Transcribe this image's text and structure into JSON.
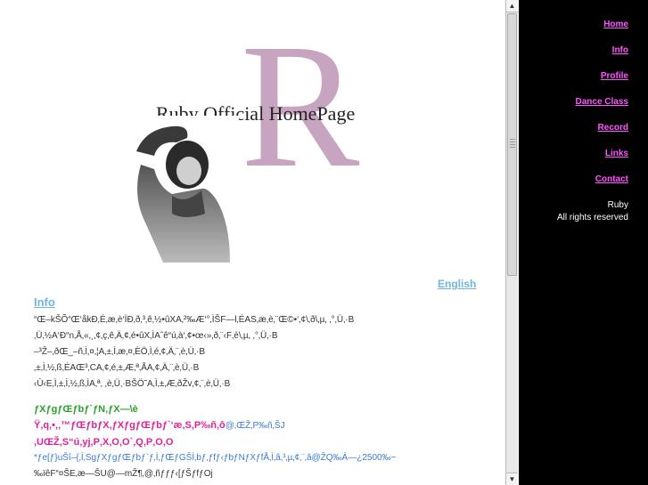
{
  "site": {
    "title": "Ruby Official HomePage",
    "logo_letter": "R"
  },
  "content": {
    "english_link": "English",
    "info_heading": "Info",
    "info_lines": [
      "“Œ–kŠÕ“Œ‘åkÐ‚É‚æ‚è‘ÏÐ‚ð‚³‚ê‚½•ûXA‚²‰Æ‘°‚ÌŠF—l‚ÉAS‚æ‚è‚¨Œ©•‘‚¢\\‚ð\\‚µ‚ ‚°‚Ü‚·B",
      "‚Ü‚½A‘Ð“n‚Å‚«‚¸‚¢‚ç‚ê‚Ä‚¢‚é•ûX‚ÌAˆê“ú‚à‘‚¢•œ‹»‚ð‚¨‹F‚è\\‚µ‚ ‚°‚Ü‚·B",
      "–³Ž–‚ðŒ_–ñ‚Ì‚¤‚¦A‚±‚Ì‚æ‚¤‚ÈÖ‚Ì‚é‚¢‚Ä‚¨‚è‚Ü‚·B",
      "‚±‚Ì‚½‚ß‚ÉAŒ³‚CA‚¢‚é‚±‚Æ‚ª‚ÅA‚¢‚Ä‚¨‚è‚Ü‚·B",
      "‹Ù‹E‚Ì‚±‚Ì‚½‚ß‚ÌA‚ª‚ ‚è‚Ü‚·BŠÖ˜A‚Ì‚±‚Æ‚ðŽv‚¢‚¨‚è‚Ü‚·B"
    ],
    "event_title": "ƒXƒgƒŒƒbƒ`ƒN‚ƒX—\\è",
    "event_subtitle": "Ÿ‚q‚•‚‚™ƒŒƒbƒX‚ƒXƒgƒŒƒbƒ`‘æ‚S‚P‰ñ‚ô",
    "event_tag": "@‚ŒŽ‚P‰ñ‚ŠJ",
    "event_schedule": ",UŒŽ‚S“ú‚yj‚P‚X‚O‚O`‚Q‚P‚O‚O",
    "event_detail": "*ƒe[ƒ}uŠî–{‚Ì‚SgƒXƒgƒŒƒbƒ`ƒ‚Ì‚ƒŒƒGŠÌ‚bƒ‚ƒfƒ‹ƒbƒNƒXƒf",
    "event_price": "Å‚Ì‚â‚³‚µ‚¢‚¨‚â@ŽQ‰Á—¿2500‰~",
    "event_more": "‰ïêF“¤ŠE‚æ—ŠU@—mŽ¶‚@‚ñƒƒƒ‹[ƒŠƒfƒOj"
  },
  "nav": {
    "items": [
      "Home",
      "Info",
      "Profile",
      "Dance Class",
      "Record",
      "Links",
      "Contact"
    ],
    "footer_name": "Ruby",
    "footer_rights": "All rights reserved"
  },
  "colors": {
    "accent_pink": "#ff55ff",
    "link_blue": "#6fb5e4",
    "logo_mauve": "#c7a5c0",
    "nav_bg": "#000000"
  }
}
